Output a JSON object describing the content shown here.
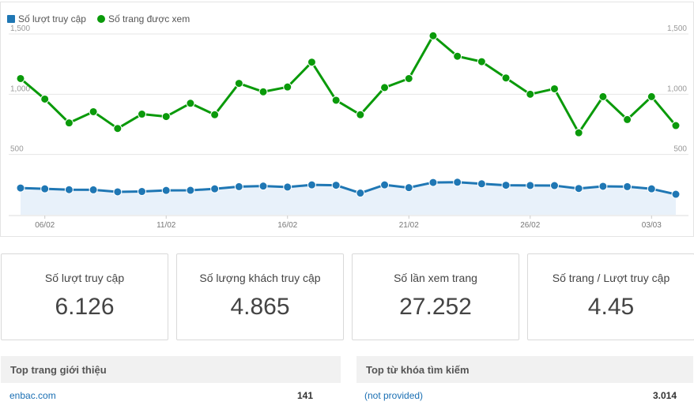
{
  "chart_data": {
    "type": "line",
    "x": [
      "05/02",
      "06/02",
      "07/02",
      "08/02",
      "09/02",
      "10/02",
      "11/02",
      "12/02",
      "13/02",
      "14/02",
      "15/02",
      "16/02",
      "17/02",
      "18/02",
      "19/02",
      "20/02",
      "21/02",
      "22/02",
      "23/02",
      "24/02",
      "25/02",
      "26/02",
      "27/02",
      "28/02",
      "01/03",
      "02/03",
      "03/03",
      "04/03"
    ],
    "xticks": [
      "06/02",
      "11/02",
      "16/02",
      "21/02",
      "26/02",
      "03/03"
    ],
    "yticks": [
      "1,500",
      "1,000",
      "500"
    ],
    "ylim": [
      0,
      1500
    ],
    "series": [
      {
        "name": "Số lượt truy cập",
        "color": "#1f77b4",
        "values": [
          222,
          215,
          208,
          207,
          190,
          193,
          202,
          203,
          215,
          233,
          238,
          230,
          248,
          245,
          180,
          248,
          225,
          268,
          270,
          257,
          245,
          243,
          242,
          218,
          236,
          233,
          215,
          170
        ]
      },
      {
        "name": "Số trang được xem",
        "color": "#0a9a0a",
        "values": [
          1130,
          960,
          762,
          855,
          716,
          835,
          815,
          925,
          830,
          1090,
          1020,
          1060,
          1266,
          950,
          830,
          1055,
          1130,
          1485,
          1315,
          1270,
          1135,
          1000,
          1045,
          680,
          980,
          790,
          980,
          740
        ]
      }
    ]
  },
  "stats": [
    {
      "label": "Số lượt truy cập",
      "value": "6.126"
    },
    {
      "label": "Số lượng khách truy cập",
      "value": "4.865"
    },
    {
      "label": "Số lần xem trang",
      "value": "27.252"
    },
    {
      "label": "Số trang / Lượt truy cập",
      "value": "4.45"
    }
  ],
  "top_referrers": {
    "title": "Top trang giới thiệu",
    "rows": [
      {
        "name": "enbac.com",
        "count": "141"
      }
    ]
  },
  "top_keywords": {
    "title": "Top từ khóa tìm kiếm",
    "rows": [
      {
        "name": "(not provided)",
        "count": "3.014"
      }
    ]
  }
}
